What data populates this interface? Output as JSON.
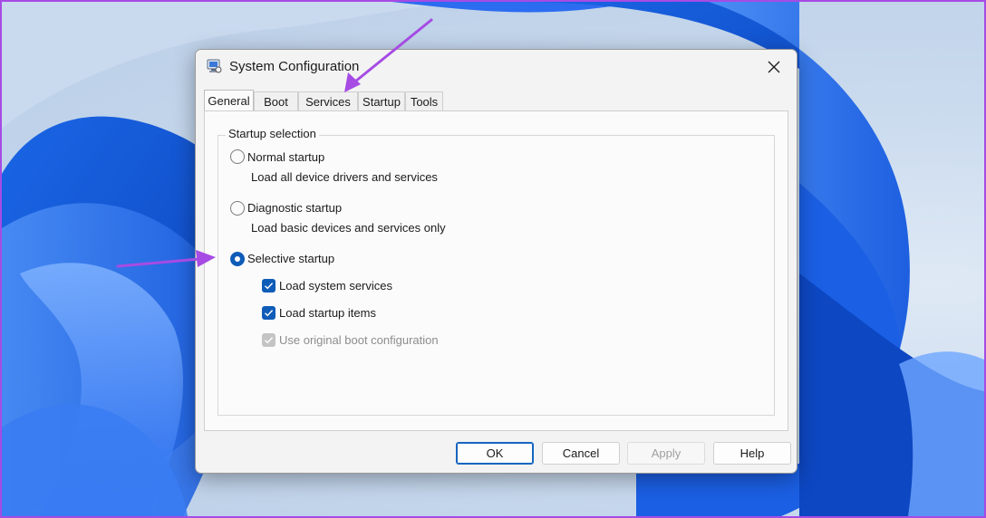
{
  "window": {
    "title": "System Configuration",
    "icon": "system-configuration-icon",
    "close_icon": "close-icon"
  },
  "tabs": [
    {
      "label": "General",
      "active": true
    },
    {
      "label": "Boot",
      "active": false
    },
    {
      "label": "Services",
      "active": false
    },
    {
      "label": "Startup",
      "active": false
    },
    {
      "label": "Tools",
      "active": false
    }
  ],
  "startup_selection": {
    "group_label": "Startup selection",
    "normal": {
      "label": "Normal startup",
      "description": "Load all device drivers and services",
      "selected": false
    },
    "diagnostic": {
      "label": "Diagnostic startup",
      "description": "Load basic devices and services only",
      "selected": false
    },
    "selective": {
      "label": "Selective startup",
      "selected": true,
      "options": [
        {
          "label": "Load system services",
          "checked": true,
          "enabled": true
        },
        {
          "label": "Load startup items",
          "checked": true,
          "enabled": true
        },
        {
          "label": "Use original boot configuration",
          "checked": true,
          "enabled": false
        }
      ]
    }
  },
  "buttons": {
    "ok": "OK",
    "cancel": "Cancel",
    "apply": "Apply",
    "help": "Help"
  },
  "colors": {
    "accent": "#0f5cb8",
    "annotation_arrow": "#a64be4",
    "screenshot_border": "#a64be4"
  }
}
